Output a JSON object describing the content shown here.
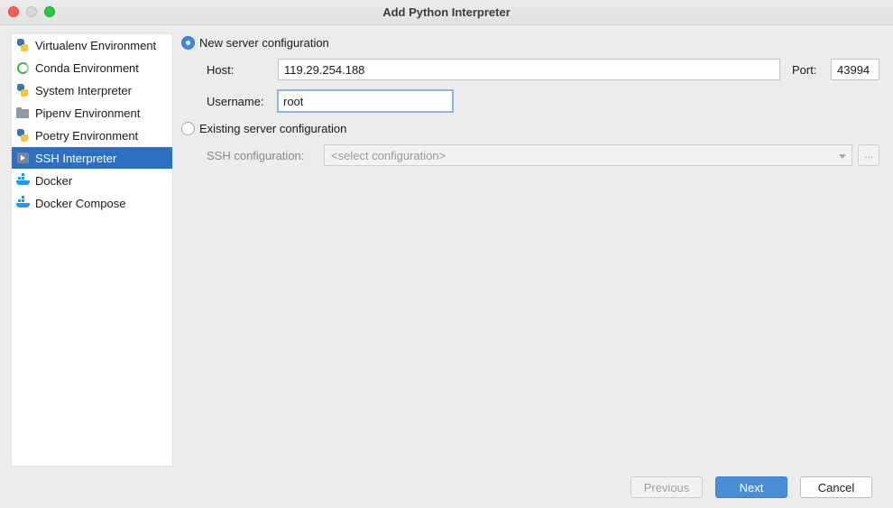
{
  "window": {
    "title": "Add Python Interpreter"
  },
  "sidebar": {
    "items": [
      {
        "label": "Virtualenv Environment",
        "icon": "python-icon"
      },
      {
        "label": "Conda Environment",
        "icon": "conda-icon"
      },
      {
        "label": "System Interpreter",
        "icon": "python-icon"
      },
      {
        "label": "Pipenv Environment",
        "icon": "folder-icon"
      },
      {
        "label": "Poetry Environment",
        "icon": "python-icon"
      },
      {
        "label": "SSH Interpreter",
        "icon": "ssh-icon",
        "selected": true
      },
      {
        "label": "Docker",
        "icon": "docker-icon"
      },
      {
        "label": "Docker Compose",
        "icon": "docker-icon"
      }
    ]
  },
  "main": {
    "new_server": {
      "label": "New server configuration",
      "checked": true,
      "host_label": "Host:",
      "host_value": "119.29.254.188",
      "port_label": "Port:",
      "port_value": "43994",
      "username_label": "Username:",
      "username_value": "root"
    },
    "existing_server": {
      "label": "Existing server configuration",
      "checked": false,
      "ssh_config_label": "SSH configuration:",
      "ssh_config_placeholder": "<select configuration>",
      "browse_label": "..."
    }
  },
  "footer": {
    "previous_label": "Previous",
    "next_label": "Next",
    "cancel_label": "Cancel"
  },
  "colors": {
    "selection": "#2e6fc4",
    "primary_button": "#4a8ed8",
    "radio_checked": "#3b87e6"
  }
}
